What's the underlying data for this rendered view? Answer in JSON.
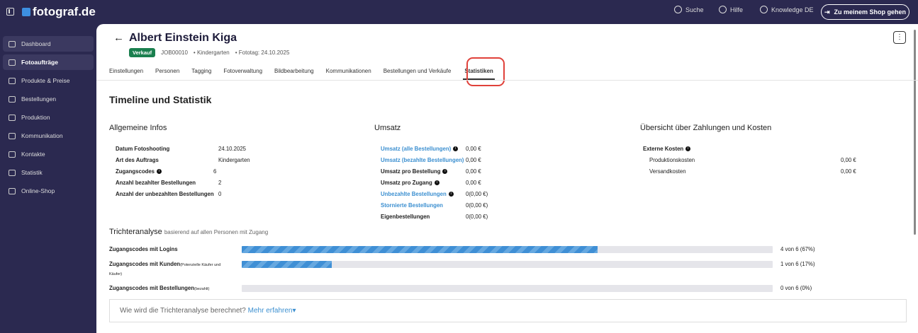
{
  "brand": "fotograf.de",
  "topnav": {
    "search": "Suche",
    "help": "Hilfe",
    "knowledge": "Knowledge DE",
    "shop_button": "Zu meinem Shop gehen"
  },
  "sidebar": {
    "items": [
      {
        "label": "Dashboard"
      },
      {
        "label": "Fotoaufträge"
      },
      {
        "label": "Produkte & Preise"
      },
      {
        "label": "Bestellungen"
      },
      {
        "label": "Produktion"
      },
      {
        "label": "Kommunikation"
      },
      {
        "label": "Kontakte"
      },
      {
        "label": "Statistik"
      },
      {
        "label": "Online-Shop"
      }
    ]
  },
  "header": {
    "title": "Albert Einstein Kiga",
    "badge": "Verkauf",
    "job": "JOB00010",
    "type": "• Kindergarten",
    "date": "• Fototag: 24.10.2025",
    "menu": "⋮"
  },
  "tabs": [
    "Einstellungen",
    "Personen",
    "Tagging",
    "Fotoverwaltung",
    "Bildbearbeitung",
    "Kommunikationen",
    "Bestellungen und Verkäufe",
    "Statistiken"
  ],
  "page_title": "Timeline und Statistik",
  "general": {
    "title": "Allgemeine Infos",
    "rows": [
      [
        "Datum Fotoshooting",
        "24.10.2025"
      ],
      [
        "Art des Auftrags",
        "Kindergarten"
      ],
      [
        "Zugangscodes",
        "6"
      ],
      [
        "Anzahl bezahlter Bestellungen",
        "2"
      ],
      [
        "Anzahl der unbezahlten Bestellungen",
        "0"
      ]
    ]
  },
  "revenue": {
    "title": "Umsatz",
    "rows": [
      [
        "Umsatz (alle Bestellungen)",
        "0,00 €"
      ],
      [
        "Umsatz (bezahlte Bestellungen)",
        "0,00 €"
      ],
      [
        "Umsatz pro Bestellung",
        "0,00 €"
      ],
      [
        "Umsatz pro Zugang",
        "0,00 €"
      ],
      [
        "Unbezahlte Bestellungen",
        "0(0,00 €)"
      ],
      [
        "Stornierte Bestellungen",
        "0(0,00 €)"
      ],
      [
        "Eigenbestellungen",
        "0(0,00 €)"
      ]
    ]
  },
  "costs": {
    "title": "Übersicht über Zahlungen und Kosten",
    "external": "Externe Kosten",
    "rows": [
      [
        "Produktionskosten",
        "0,00 €"
      ],
      [
        "Versandkosten",
        "0,00 €"
      ]
    ]
  },
  "funnel": {
    "title": "Trichteranalyse",
    "subtitle": "basierend auf allen Personen mit Zugang",
    "rows": [
      {
        "label": "Zugangscodes mit Logins",
        "note": "",
        "value": "4 von 6 (67%)",
        "percent": 67
      },
      {
        "label": "Zugangscodes mit Kunden",
        "note": "(Potenzielle Käufer und Käufer)",
        "value": "1 von 6 (17%)",
        "percent": 17
      },
      {
        "label": "Zugangscodes mit Bestellungen",
        "note": "(bezahlt)",
        "value": "0 von 6 (0%)",
        "percent": 0
      }
    ],
    "how_text": "Wie wird die Trichteranalyse berechnet?",
    "how_link": "Mehr erfahren"
  }
}
